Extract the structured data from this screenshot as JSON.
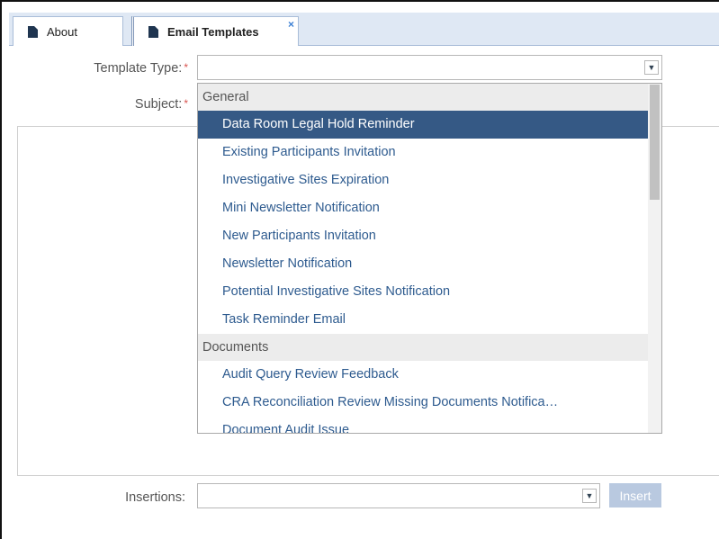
{
  "tabs": [
    {
      "label": "About",
      "close": ""
    },
    {
      "label": "Email Templates",
      "close": "×"
    }
  ],
  "form": {
    "template_type_label": "Template Type:",
    "subject_label": "Subject:",
    "required_mark": "*",
    "template_type_value": "",
    "insertions_label": "Insertions:",
    "insertions_value": "",
    "insert_button": "Insert"
  },
  "dropdown": {
    "groups": [
      {
        "name": "General",
        "options": [
          "Data Room Legal Hold Reminder",
          "Existing Participants Invitation",
          "Investigative Sites Expiration",
          "Mini Newsletter Notification",
          "New Participants Invitation",
          "Newsletter Notification",
          "Potential Investigative Sites Notification",
          "Task Reminder Email"
        ]
      },
      {
        "name": "Documents",
        "options": [
          "Audit Query Review Feedback",
          "CRA Reconciliation Review Missing Documents Notifica…",
          "Document Audit Issue"
        ]
      }
    ],
    "selected": "Data Room Legal Hold Reminder"
  },
  "icons": {
    "tab_doc": "document-icon",
    "chevron": "chevron-down-icon"
  },
  "colors": {
    "selected_bg": "#355985",
    "option_text": "#2e5b8f",
    "required": "#d9534f"
  }
}
